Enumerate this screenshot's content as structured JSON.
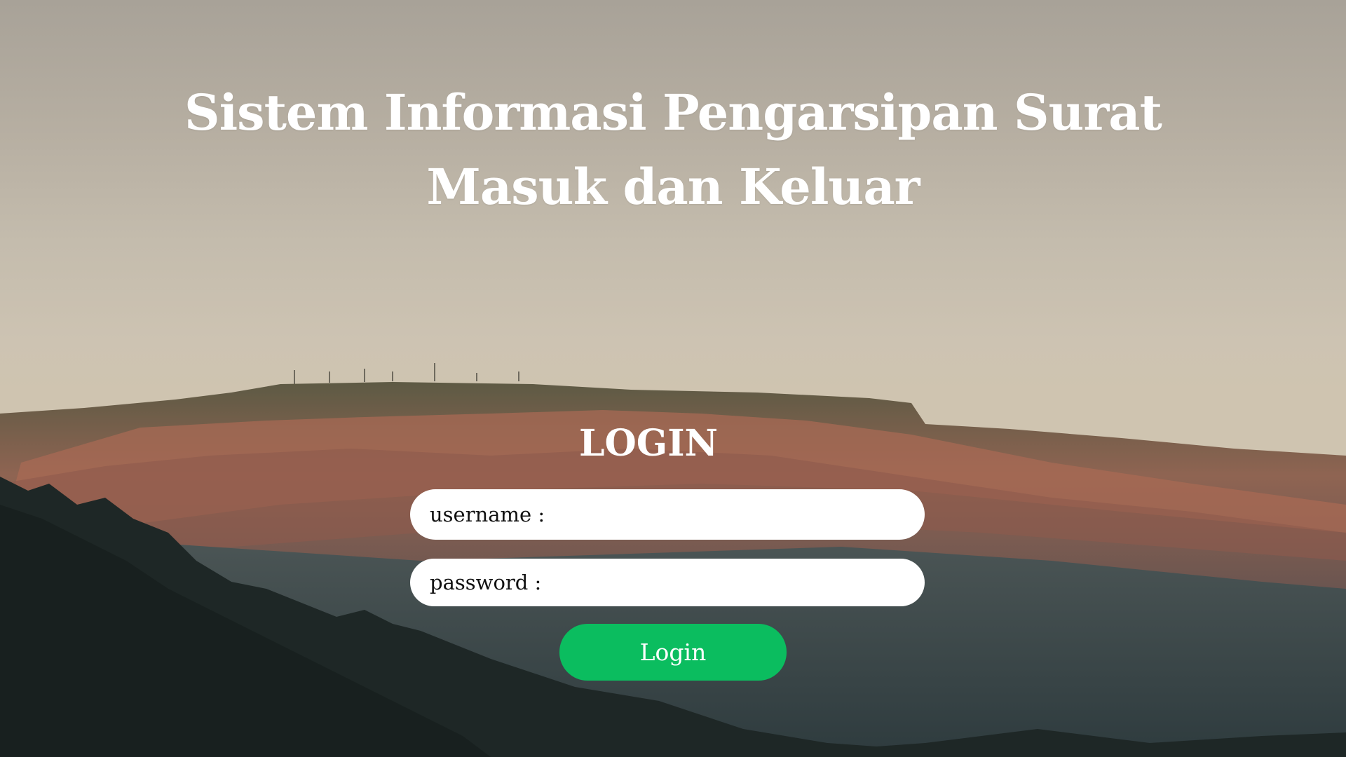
{
  "header": {
    "title_line1": "Sistem Informasi Pengarsipan Surat",
    "title_line2": "Masuk dan Keluar"
  },
  "login": {
    "heading": "LOGIN",
    "username_label": "username :",
    "username_value": "",
    "password_label": "password :",
    "password_value": "",
    "button_label": "Login"
  },
  "colors": {
    "button": "#0bbd5f",
    "text": "#ffffff",
    "field_bg": "#ffffff"
  }
}
